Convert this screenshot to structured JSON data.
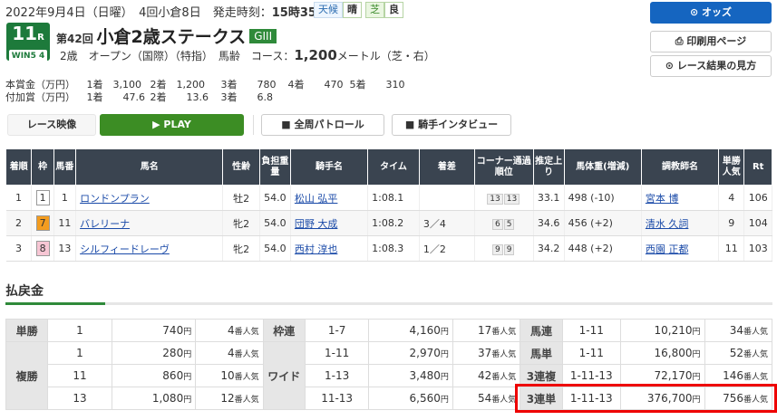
{
  "header": {
    "date": "2022年9月4日（日曜）",
    "meeting": "4回小倉8日",
    "post_label": "発走時刻：",
    "post_time": "15時35分",
    "weather_label": "天候",
    "weather": "晴",
    "track_label": "芝",
    "track_cond": "良"
  },
  "race": {
    "number": "11",
    "number_suffix": "R",
    "win5": "WIN5 4",
    "kai": "第42回",
    "name": "小倉2歳ステークス",
    "grade": "GIII",
    "cond1": "2歳　オープン（国際）（特指）　馬齢",
    "course_label": "　コース：",
    "distance": "1,200",
    "course_unit": "メートル（芝・右）"
  },
  "prize": {
    "main_label": "本賞金（万円）",
    "main": [
      "1着　3,100",
      "2着　1,200",
      "3着　　780",
      "4着　　470",
      "5着　　310"
    ],
    "add_label": "付加賞（万円）",
    "add": [
      "1着　　47.6",
      "2着　　13.6",
      "3着　　6.8"
    ]
  },
  "buttons": {
    "odds": "⊙ オッズ",
    "print": "⎙ 印刷用ページ",
    "result": "⊙ レース結果の見方",
    "video": "レース映像",
    "play": "▶ PLAY",
    "patrol": "■ 全周パトロール",
    "interview": "■ 騎手インタビュー"
  },
  "result_headers": [
    "着順",
    "枠",
    "馬番",
    "馬名",
    "性齢",
    "負担重量",
    "騎手名",
    "タイム",
    "着差",
    "コーナー通過順位",
    "推定上り",
    "馬体重(増減)",
    "調教師名",
    "単勝人気",
    "Rt"
  ],
  "results": [
    {
      "pos": "1",
      "waku": "1",
      "waku_color": "#ffffff",
      "umaban": "1",
      "horse": "ロンドンプラン",
      "sex": "牡2",
      "weight": "54.0",
      "jockey": "松山 弘平",
      "time": "1:08.1",
      "margin": "",
      "corner": [
        "13",
        "13"
      ],
      "last3f": "33.1",
      "body": "498 (-10)",
      "trainer": "宮本 博",
      "pop": "4",
      "rt": "106"
    },
    {
      "pos": "2",
      "waku": "7",
      "waku_color": "#f39c1f",
      "umaban": "11",
      "horse": "バレリーナ",
      "sex": "牝2",
      "weight": "54.0",
      "jockey": "団野 大成",
      "time": "1:08.2",
      "margin": "3／4",
      "corner": [
        "6",
        "5"
      ],
      "last3f": "34.6",
      "body": "456 (+2)",
      "trainer": "清水 久詞",
      "pop": "9",
      "rt": "104"
    },
    {
      "pos": "3",
      "waku": "8",
      "waku_color": "#f7c6d4",
      "umaban": "13",
      "horse": "シルフィードレーヴ",
      "sex": "牝2",
      "weight": "54.0",
      "jockey": "西村 淳也",
      "time": "1:08.3",
      "margin": "1／2",
      "corner": [
        "9",
        "9"
      ],
      "last3f": "34.2",
      "body": "448 (+2)",
      "trainer": "西園 正都",
      "pop": "11",
      "rt": "103"
    }
  ],
  "payout_title": "払戻金",
  "payouts": {
    "tansho": {
      "label": "単勝",
      "rows": [
        {
          "num": "1",
          "yen": "740",
          "pop": "4"
        }
      ]
    },
    "fukusho": {
      "label": "複勝",
      "rows": [
        {
          "num": "1",
          "yen": "280",
          "pop": "4"
        },
        {
          "num": "11",
          "yen": "860",
          "pop": "10"
        },
        {
          "num": "13",
          "yen": "1,080",
          "pop": "12"
        }
      ]
    },
    "wakuren": {
      "label": "枠連",
      "rows": [
        {
          "num": "1-7",
          "yen": "4,160",
          "pop": "17"
        }
      ]
    },
    "wide": {
      "label": "ワイド",
      "rows": [
        {
          "num": "1-11",
          "yen": "2,970",
          "pop": "37"
        },
        {
          "num": "1-13",
          "yen": "3,480",
          "pop": "42"
        },
        {
          "num": "11-13",
          "yen": "6,560",
          "pop": "54"
        }
      ]
    },
    "umaren": {
      "label": "馬連",
      "num": "1-11",
      "yen": "10,210",
      "pop": "34"
    },
    "umatan": {
      "label": "馬単",
      "num": "1-11",
      "yen": "16,800",
      "pop": "52"
    },
    "sanrenpuku": {
      "label": "3連複",
      "num": "1-11-13",
      "yen": "72,170",
      "pop": "146"
    },
    "sanrentan": {
      "label": "3連単",
      "num": "1-11-13",
      "yen": "376,700",
      "pop": "756"
    },
    "yen_unit": "円",
    "pop_unit": "番人気"
  }
}
